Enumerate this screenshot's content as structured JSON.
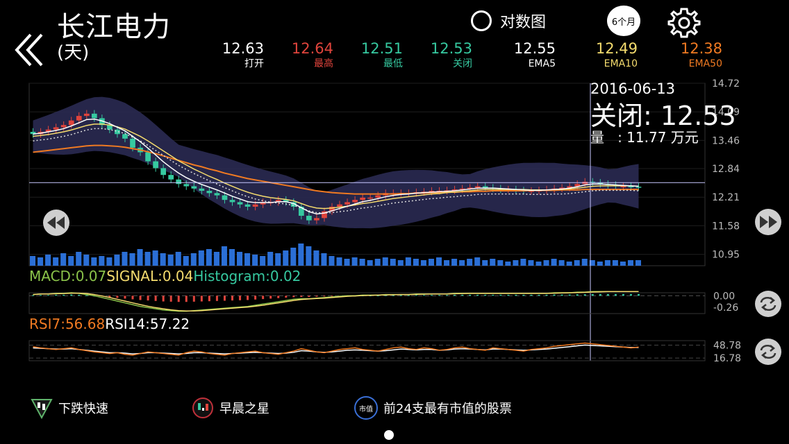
{
  "header": {
    "title": "长江电力",
    "subtitle": "(天)",
    "log_label": "对数图",
    "period_label": "6个月"
  },
  "stats": [
    {
      "value": "12.63",
      "label": "打开",
      "color": "#ffffff"
    },
    {
      "value": "12.64",
      "label": "最高",
      "color": "#e0443c"
    },
    {
      "value": "12.51",
      "label": "最低",
      "color": "#36c9a0"
    },
    {
      "value": "12.53",
      "label": "关闭",
      "color": "#36c9a0"
    },
    {
      "value": "12.55",
      "label": "EMA5",
      "color": "#ffffff"
    },
    {
      "value": "12.49",
      "label": "EMA10",
      "color": "#f5dc6e"
    },
    {
      "value": "12.38",
      "label": "EMA50",
      "color": "#f07a22"
    }
  ],
  "tooltip": {
    "date": "2016-06-13",
    "close": "关闭: 12.53",
    "volume": "量   : 11.77 万元"
  },
  "indicators": {
    "macd": "MACD:0.07",
    "signal": "SIGNAL:0.04",
    "histogram": "Histogram:0.02",
    "rsi7": "RSI7:56.68",
    "rsi14": "RSI14:57.22"
  },
  "patterns": [
    {
      "label": "下跌快速",
      "icon": "falling-fast-icon"
    },
    {
      "label": "早晨之星",
      "icon": "morning-star-icon"
    },
    {
      "label": "前24支最有市值的股票",
      "icon_text": "市值",
      "icon": "market-cap-icon"
    }
  ],
  "colors": {
    "up": "#e0443c",
    "down": "#36c9a0",
    "ema5": "#ffffff",
    "ema10": "#f5dc6e",
    "ema50": "#f07a22",
    "volume": "#2b6fd6",
    "band": "#2a2a52"
  },
  "chart_data": {
    "type": "candlestick",
    "price_ticks": [
      "14.72",
      "14.09",
      "13.46",
      "12.84",
      "12.21",
      "11.58",
      "10.95"
    ],
    "ylim": [
      10.7,
      14.72
    ],
    "crosshair_price": 12.53,
    "macd_ticks": [
      "0.00",
      "-0.26"
    ],
    "rsi_ticks": [
      "48.78",
      "16.78"
    ],
    "closes": [
      13.6,
      13.65,
      13.7,
      13.75,
      13.8,
      13.9,
      14.0,
      14.05,
      13.95,
      13.8,
      13.7,
      13.6,
      13.5,
      13.3,
      13.2,
      13.0,
      12.85,
      12.7,
      12.6,
      12.5,
      12.45,
      12.4,
      12.35,
      12.3,
      12.25,
      12.15,
      12.1,
      12.05,
      12.0,
      12.05,
      12.1,
      12.1,
      12.15,
      12.1,
      12.0,
      11.8,
      11.7,
      11.75,
      11.9,
      12.0,
      12.05,
      12.1,
      12.15,
      12.2,
      12.2,
      12.25,
      12.3,
      12.3,
      12.3,
      12.3,
      12.32,
      12.33,
      12.35,
      12.35,
      12.36,
      12.38,
      12.4,
      12.42,
      12.45,
      12.42,
      12.4,
      12.38,
      12.38,
      12.36,
      12.35,
      12.35,
      12.36,
      12.38,
      12.4,
      12.42,
      12.45,
      12.5,
      12.55,
      12.53,
      12.5,
      12.48,
      12.45,
      12.45,
      12.44,
      12.43
    ],
    "ema5": [
      13.6,
      13.62,
      13.65,
      13.68,
      13.72,
      13.78,
      13.85,
      13.92,
      13.93,
      13.89,
      13.83,
      13.75,
      13.67,
      13.55,
      13.43,
      13.29,
      13.14,
      12.99,
      12.86,
      12.74,
      12.64,
      12.56,
      12.49,
      12.43,
      12.37,
      12.3,
      12.23,
      12.17,
      12.11,
      12.09,
      12.09,
      12.09,
      12.11,
      12.11,
      12.07,
      11.98,
      11.89,
      11.84,
      11.86,
      11.91,
      11.96,
      12.01,
      12.06,
      12.11,
      12.14,
      12.18,
      12.22,
      12.25,
      12.27,
      12.28,
      12.3,
      12.31,
      12.32,
      12.33,
      12.34,
      12.35,
      12.37,
      12.39,
      12.41,
      12.41,
      12.41,
      12.4,
      12.39,
      12.38,
      12.37,
      12.36,
      12.36,
      12.37,
      12.38,
      12.39,
      12.41,
      12.44,
      12.48,
      12.5,
      12.5,
      12.49,
      12.48,
      12.47,
      12.46,
      12.45
    ],
    "ema10": [
      13.55,
      13.57,
      13.59,
      13.62,
      13.65,
      13.69,
      13.74,
      13.79,
      13.82,
      13.82,
      13.8,
      13.76,
      13.71,
      13.63,
      13.55,
      13.45,
      13.34,
      13.23,
      13.12,
      13.01,
      12.92,
      12.83,
      12.75,
      12.67,
      12.6,
      12.52,
      12.45,
      12.38,
      12.32,
      12.27,
      12.23,
      12.2,
      12.18,
      12.16,
      12.13,
      12.07,
      12.01,
      11.97,
      11.96,
      11.97,
      11.99,
      12.01,
      12.04,
      12.07,
      12.09,
      12.12,
      12.15,
      12.18,
      12.2,
      12.22,
      12.24,
      12.26,
      12.28,
      12.29,
      12.31,
      12.32,
      12.34,
      12.35,
      12.37,
      12.38,
      12.38,
      12.38,
      12.38,
      12.38,
      12.38,
      12.37,
      12.37,
      12.37,
      12.38,
      12.38,
      12.39,
      12.41,
      12.43,
      12.45,
      12.46,
      12.46,
      12.46,
      12.46,
      12.46,
      12.45
    ],
    "ema50": [
      13.2,
      13.22,
      13.24,
      13.26,
      13.28,
      13.3,
      13.32,
      13.34,
      13.35,
      13.35,
      13.34,
      13.33,
      13.31,
      13.28,
      13.25,
      13.21,
      13.17,
      13.12,
      13.07,
      13.02,
      12.97,
      12.92,
      12.88,
      12.83,
      12.79,
      12.74,
      12.7,
      12.66,
      12.62,
      12.59,
      12.56,
      12.53,
      12.5,
      12.47,
      12.44,
      12.41,
      12.38,
      12.35,
      12.33,
      12.31,
      12.3,
      12.29,
      12.28,
      12.28,
      12.28,
      12.28,
      12.28,
      12.28,
      12.29,
      12.29,
      12.3,
      12.3,
      12.31,
      12.31,
      12.32,
      12.32,
      12.33,
      12.33,
      12.34,
      12.34,
      12.35,
      12.35,
      12.35,
      12.35,
      12.35,
      12.36,
      12.36,
      12.36,
      12.36,
      12.37,
      12.37,
      12.37,
      12.38,
      12.38,
      12.38,
      12.38,
      12.38,
      12.38,
      12.38,
      12.38
    ],
    "volumes": [
      0.35,
      0.3,
      0.4,
      0.3,
      0.45,
      0.35,
      0.5,
      0.4,
      0.3,
      0.35,
      0.3,
      0.4,
      0.5,
      0.45,
      0.6,
      0.5,
      0.55,
      0.45,
      0.4,
      0.5,
      0.35,
      0.45,
      0.55,
      0.6,
      0.5,
      0.7,
      0.6,
      0.5,
      0.45,
      0.4,
      0.35,
      0.5,
      0.45,
      0.55,
      0.65,
      0.8,
      0.7,
      0.55,
      0.45,
      0.35,
      0.3,
      0.25,
      0.3,
      0.25,
      0.2,
      0.25,
      0.3,
      0.25,
      0.2,
      0.3,
      0.25,
      0.2,
      0.25,
      0.3,
      0.2,
      0.25,
      0.2,
      0.25,
      0.3,
      0.2,
      0.25,
      0.2,
      0.15,
      0.2,
      0.25,
      0.2,
      0.15,
      0.2,
      0.25,
      0.2,
      0.15,
      0.2,
      0.25,
      0.2,
      0.15,
      0.2,
      0.2,
      0.15,
      0.2,
      0.2
    ],
    "macd": [
      0.02,
      0.03,
      0.03,
      0.04,
      0.04,
      0.05,
      0.04,
      0.02,
      0.0,
      -0.03,
      -0.06,
      -0.09,
      -0.12,
      -0.15,
      -0.18,
      -0.2,
      -0.22,
      -0.24,
      -0.25,
      -0.26,
      -0.26,
      -0.25,
      -0.24,
      -0.23,
      -0.22,
      -0.21,
      -0.2,
      -0.19,
      -0.18,
      -0.16,
      -0.14,
      -0.12,
      -0.1,
      -0.08,
      -0.06,
      -0.05,
      -0.05,
      -0.04,
      -0.03,
      -0.02,
      -0.01,
      0.0,
      0.0,
      0.01,
      0.01,
      0.01,
      0.02,
      0.02,
      0.02,
      0.02,
      0.03,
      0.03,
      0.03,
      0.03,
      0.03,
      0.04,
      0.04,
      0.04,
      0.04,
      0.04,
      0.04,
      0.04,
      0.04,
      0.04,
      0.04,
      0.04,
      0.04,
      0.04,
      0.05,
      0.05,
      0.05,
      0.06,
      0.06,
      0.07,
      0.07,
      0.07,
      0.07,
      0.07,
      0.07,
      0.07
    ],
    "rsi7": [
      45,
      42,
      40,
      38,
      40,
      42,
      38,
      35,
      32,
      30,
      28,
      30,
      26,
      24,
      28,
      32,
      30,
      28,
      26,
      24,
      30,
      34,
      32,
      28,
      26,
      24,
      28,
      30,
      32,
      34,
      30,
      28,
      26,
      30,
      34,
      40,
      36,
      32,
      30,
      34,
      38,
      40,
      42,
      38,
      36,
      34,
      38,
      42,
      44,
      40,
      38,
      42,
      40,
      36,
      38,
      42,
      44,
      40,
      38,
      36,
      42,
      40,
      38,
      36,
      34,
      38,
      40,
      42,
      46,
      48,
      50,
      52,
      54,
      52,
      50,
      48,
      46,
      44,
      42,
      44
    ],
    "rsi14": [
      42,
      41,
      40,
      39,
      39,
      40,
      38,
      36,
      34,
      32,
      30,
      30,
      29,
      27,
      28,
      30,
      30,
      29,
      28,
      27,
      28,
      30,
      30,
      29,
      28,
      27,
      28,
      29,
      30,
      31,
      30,
      29,
      28,
      29,
      31,
      35,
      34,
      32,
      31,
      32,
      34,
      36,
      37,
      36,
      35,
      34,
      35,
      37,
      39,
      38,
      37,
      38,
      38,
      36,
      37,
      39,
      40,
      39,
      38,
      37,
      39,
      39,
      38,
      37,
      36,
      37,
      38,
      39,
      41,
      43,
      45,
      47,
      49,
      48,
      47,
      46,
      45,
      44,
      43,
      43
    ]
  }
}
